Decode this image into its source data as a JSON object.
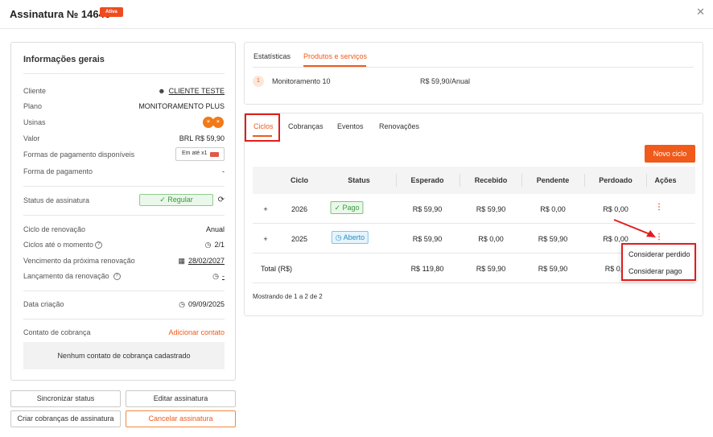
{
  "header": {
    "title": "Assinatura № 14646",
    "status_badge": "Ativa",
    "close_icon": "close-icon"
  },
  "info": {
    "title": "Informações gerais",
    "client_label": "Cliente",
    "client_value": "CLIENTE TESTE",
    "plan_label": "Plano",
    "plan_value": "MONITORAMENTO PLUS",
    "usinas_label": "Usinas",
    "value_label": "Valor",
    "value_value": "BRL R$ 59,90",
    "payment_methods_label": "Formas de pagamento disponíveis",
    "payment_methods_value": "Em até x1",
    "payment_method_label": "Forma de pagamento",
    "payment_method_value": "-",
    "status_label": "Status de assinatura",
    "status_value": "Regular",
    "renewal_cycle_label": "Ciclo de renovação",
    "renewal_cycle_value": "Anual",
    "cycles_so_far_label": "Ciclos até o momento",
    "cycles_so_far_value": "2/1",
    "next_due_label": "Vencimento da próxima renovação",
    "next_due_value": "28/02/2027",
    "renewal_launch_label": "Lançamento da renovação",
    "renewal_launch_value": "-",
    "created_label": "Data criação",
    "created_value": "09/09/2025",
    "billing_contact_label": "Contato de cobrança",
    "add_contact_link": "Adicionar contato",
    "no_contact_text": "Nenhum contato de cobrança cadastrado"
  },
  "actions": {
    "sync": "Sincronizar status",
    "edit": "Editar assinatura",
    "create_charges": "Criar cobranças de assinatura",
    "cancel": "Cancelar assinatura"
  },
  "products": {
    "tabs": [
      "Estatísticas",
      "Produtos e serviços"
    ],
    "active_tab": "Produtos e serviços",
    "items": [
      {
        "index": "1",
        "name": "Monitoramento 10",
        "price": "R$ 59,90/Anual"
      }
    ]
  },
  "cycles": {
    "tabs": [
      "Ciclos",
      "Cobranças",
      "Eventos",
      "Renovações"
    ],
    "active_tab": "Ciclos",
    "new_cycle_button": "Novo ciclo",
    "columns": [
      "Ciclo",
      "Status",
      "Esperado",
      "Recebido",
      "Pendente",
      "Perdoado",
      "Ações"
    ],
    "rows": [
      {
        "expand": "+",
        "cycle": "2026",
        "status": "Pago",
        "expected": "R$ 59,90",
        "received": "R$ 59,90",
        "pending": "R$ 0,00",
        "forgiven": "R$ 0,00"
      },
      {
        "expand": "+",
        "cycle": "2025",
        "status": "Aberto",
        "expected": "R$ 59,90",
        "received": "R$ 0,00",
        "pending": "R$ 59,90",
        "forgiven": "R$ 0,00"
      }
    ],
    "total": {
      "label": "Total (R$)",
      "expected": "R$ 119,80",
      "received": "R$ 59,90",
      "pending": "R$ 59,90",
      "forgiven": "R$ 0,0"
    },
    "footer": "Mostrando de 1 a 2 de 2"
  },
  "row_menu": {
    "items": [
      "Considerar perdido",
      "Considerar pago"
    ]
  },
  "colors": {
    "accent": "#f05a1a",
    "highlight": "#e01d1d",
    "success": "#3a9a3a",
    "info": "#2a8fc7"
  }
}
